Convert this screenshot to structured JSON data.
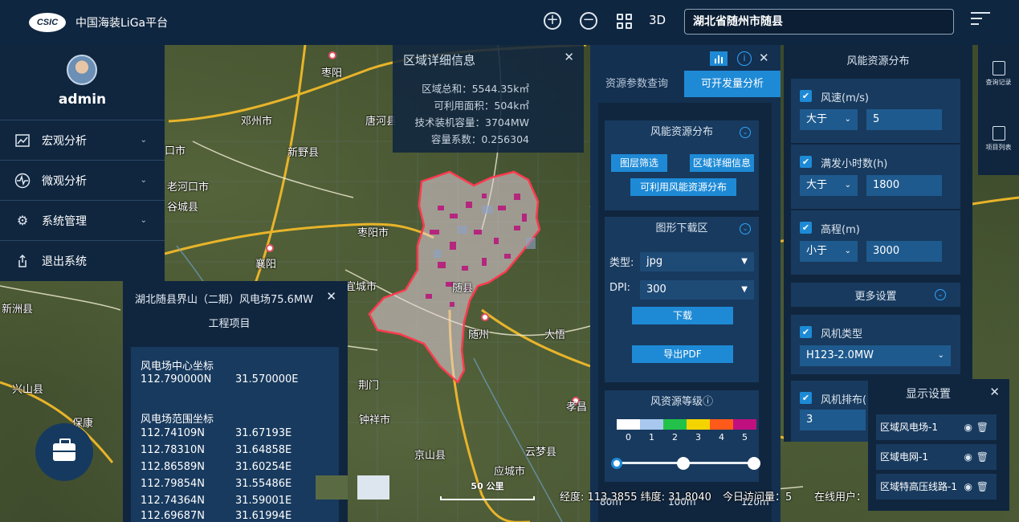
{
  "header": {
    "logo_text": "CSIC",
    "app_title": "中国海装LiGa平台",
    "mode_3d": "3D",
    "region_search": "湖北省随州市随县"
  },
  "sidebar": {
    "username": "admin",
    "items": [
      {
        "label": "宏观分析",
        "icon": "chart-icon"
      },
      {
        "label": "微观分析",
        "icon": "pulse-icon"
      },
      {
        "label": "系统管理",
        "icon": "gear-icon"
      },
      {
        "label": "退出系统",
        "icon": "logout-icon"
      }
    ]
  },
  "region_detail": {
    "title": "区域详细信息",
    "total": "区域总和：5544.35k㎡",
    "usable": "可利用面积：504k㎡",
    "capacity": "技术装机容量：3704MW",
    "factor": "容量系数：0.256304"
  },
  "analysis": {
    "tabs": [
      "资源参数查询",
      "可开发量分析"
    ],
    "active_tab": 1,
    "wind_section": {
      "title": "风能资源分布",
      "buttons": [
        "图层筛选",
        "区域详细信息",
        "可利用风能资源分布"
      ]
    },
    "download_section": {
      "title": "图形下载区",
      "type_label": "类型:",
      "type_value": "jpg",
      "dpi_label": "DPI:",
      "dpi_value": "300",
      "download_btn": "下载",
      "pdf_btn": "导出PDF"
    },
    "level_section": {
      "title": "风资源等级ⓘ",
      "levels": [
        "0",
        "1",
        "2",
        "3",
        "4",
        "5"
      ],
      "colors": [
        "#ffffff",
        "#a8c8f0",
        "#22c24a",
        "#f3d400",
        "#ff5a1a",
        "#c01080"
      ],
      "heights": [
        "80m",
        "100m",
        "120m"
      ]
    }
  },
  "wind_panel": {
    "title": "风能资源分布",
    "filters": [
      {
        "label": "风速(m/s)",
        "op": "大于",
        "value": "5"
      },
      {
        "label": "满发小时数(h)",
        "op": "大于",
        "value": "1800"
      },
      {
        "label": "高程(m)",
        "op": "小于",
        "value": "3000"
      }
    ],
    "more_settings": "更多设置",
    "turbine_type_label": "风机类型",
    "turbine_type_value": "H123-2.0MW",
    "layout_label": "风机排布(",
    "layout_value": "3"
  },
  "right_bar": {
    "query_record": "查询记录",
    "project_list": "项目列表"
  },
  "display_settings": {
    "title": "显示设置",
    "layers": [
      "区域风电场-1",
      "区域电网-1",
      "区域特高压线路-1"
    ]
  },
  "project": {
    "title": "湖北随县界山（二期）风电场75.6MW",
    "subtitle": "工程项目",
    "center_label": "风电场中心坐标",
    "center": [
      "112.790000N",
      "31.570000E"
    ],
    "range_label": "风电场范围坐标",
    "range": [
      [
        "112.74109N",
        "31.67193E"
      ],
      [
        "112.78310N",
        "31.64858E"
      ],
      [
        "112.86589N",
        "31.60254E"
      ],
      [
        "112.79854N",
        "31.55486E"
      ],
      [
        "112.74364N",
        "31.59001E"
      ],
      [
        "112.69687N",
        "31.61994E"
      ]
    ]
  },
  "map": {
    "scale": "50 公里",
    "coords": "经度: 113.3855 纬度: 31.8040",
    "visits": "今日访问量：5",
    "online": "在线用户：",
    "labels": [
      "枣阳",
      "邓州市",
      "唐河县",
      "新野县",
      "口市",
      "老河口市",
      "谷城县",
      "枣阳市",
      "襄阳",
      "随县",
      "随州",
      "大悟",
      "京山县",
      "孝昌",
      "应城市",
      "云梦县",
      "荆门",
      "钟祥市",
      "兴山县",
      "保康",
      "宜城市",
      "新洲县"
    ]
  }
}
